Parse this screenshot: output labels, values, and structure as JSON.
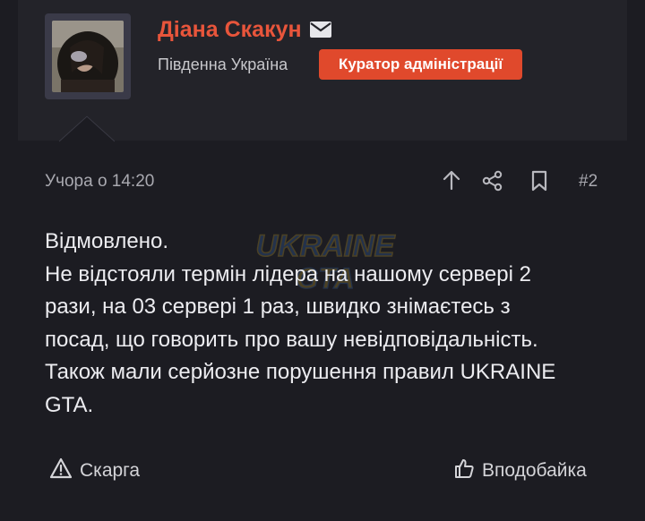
{
  "post": {
    "author": {
      "name": "Діана Скакун",
      "location": "Південна Україна",
      "role": "Куратор адміністрації"
    },
    "date": "Учора о 14:20",
    "number": "#2",
    "body": {
      "line1": "Відмовлено.",
      "line2": "Не відстояли термін лідера на нашому сервері 2",
      "line3": "рази, на 03 сервері 1 раз, швидко знімаєтесь з",
      "line4": "посад, що говорить про вашу невідповідальність.",
      "line5": "Також мали серйозне порушення правил UKRAINE",
      "line6": "GTA."
    },
    "watermark": {
      "line1": "UKRAINE",
      "line2": "GTA"
    },
    "footer": {
      "report_label": "Скарга",
      "like_label": "Вподобайка"
    }
  },
  "icons": {
    "mail": "envelope-icon",
    "upvote": "arrow-up-icon",
    "share": "share-icon",
    "bookmark": "bookmark-icon",
    "report": "warning-triangle-icon",
    "like": "thumbs-up-icon"
  },
  "colors": {
    "background": "#1c1c22",
    "header": "#232329",
    "accent": "#e8553b",
    "badge": "#e0492c"
  }
}
